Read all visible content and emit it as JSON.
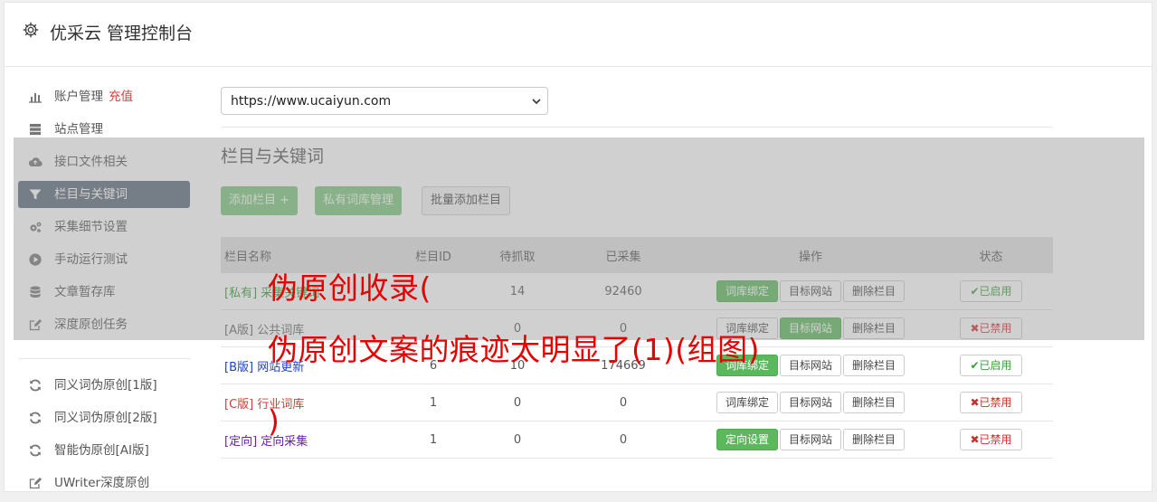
{
  "header": {
    "title": "优采云 管理控制台"
  },
  "sidebar": {
    "items": [
      {
        "label": "账户管理",
        "extra": "充值"
      },
      {
        "label": "站点管理"
      },
      {
        "label": "接口文件相关"
      },
      {
        "label": "栏目与关键词"
      },
      {
        "label": "采集细节设置"
      },
      {
        "label": "手动运行测试"
      },
      {
        "label": "文章暂存库"
      },
      {
        "label": "深度原创任务"
      }
    ],
    "items2": [
      {
        "label": "同义词伪原创[1版]"
      },
      {
        "label": "同义词伪原创[2版]"
      },
      {
        "label": "智能伪原创[AI版]"
      },
      {
        "label": "UWriter深度原创"
      }
    ]
  },
  "site_select": {
    "value": "https://www.ucaiyun.com"
  },
  "section": {
    "title": "栏目与关键词"
  },
  "buttons": {
    "add": "添加栏目 +",
    "private_lib": "私有词库管理",
    "batch_add": "批量添加栏目"
  },
  "table": {
    "headers": [
      "栏目名称",
      "栏目ID",
      "待抓取",
      "已采集",
      "操作",
      "状态"
    ],
    "rows": [
      {
        "tag": "[私有]",
        "name": "采集关键词",
        "id": "",
        "pending": "14",
        "collected": "92460",
        "op1": "词库绑定",
        "op2": "目标网站",
        "op3": "删除栏目",
        "status": "✔已启用"
      },
      {
        "tag": "[A版]",
        "name": "公共词库",
        "id": "",
        "pending": "0",
        "collected": "0",
        "op1": "词库绑定",
        "op2": "目标网站",
        "op3": "删除栏目",
        "status": "✖已禁用"
      },
      {
        "tag": "[B版]",
        "name": "网站更新",
        "id": "6",
        "pending": "10",
        "collected": "174669",
        "op1": "词库绑定",
        "op2": "目标网站",
        "op3": "删除栏目",
        "status": "✔已启用"
      },
      {
        "tag": "[C版]",
        "name": "行业词库",
        "id": "1",
        "pending": "0",
        "collected": "0",
        "op1": "词库绑定",
        "op2": "目标网站",
        "op3": "删除栏目",
        "status": "✖已禁用"
      },
      {
        "tag": "[定向]",
        "name": "定向采集",
        "id": "1",
        "pending": "0",
        "collected": "0",
        "op1": "定向设置",
        "op2": "目标网站",
        "op3": "删除栏目",
        "status": "✖已禁用"
      }
    ]
  },
  "watermark": {
    "line1": "伪原创收录(",
    "line2": "伪原创文案的痕迹太明显了(1)(组图)",
    "line3": ")"
  },
  "colors": {
    "accent_green": "#5cb85c",
    "active_nav": "#5a6878",
    "watermark_red": "#e60000"
  }
}
